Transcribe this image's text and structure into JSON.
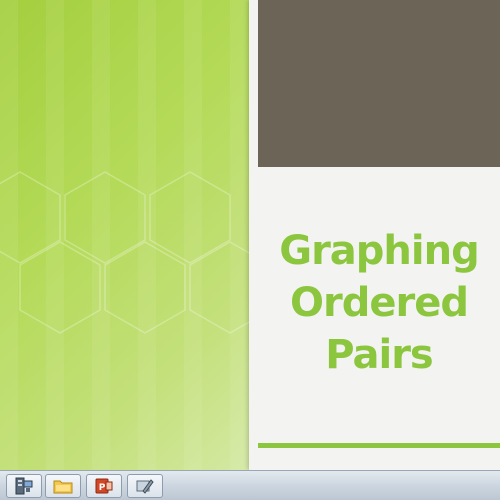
{
  "slide": {
    "title_lines": [
      "Graphing",
      "Ordered",
      "Pairs"
    ],
    "colors": {
      "background": "#b4da58",
      "panel": "#f3f3f2",
      "dark_block": "#6d6458",
      "title": "#8cc63f",
      "accent_line": "#8cc63f"
    }
  },
  "taskbar": {
    "buttons": [
      {
        "name": "computer-app",
        "icon": "computer-icon"
      },
      {
        "name": "file-explorer",
        "icon": "folder-icon"
      },
      {
        "name": "powerpoint",
        "icon": "powerpoint-icon"
      },
      {
        "name": "edit-tool",
        "icon": "pen-tool-icon"
      }
    ]
  }
}
